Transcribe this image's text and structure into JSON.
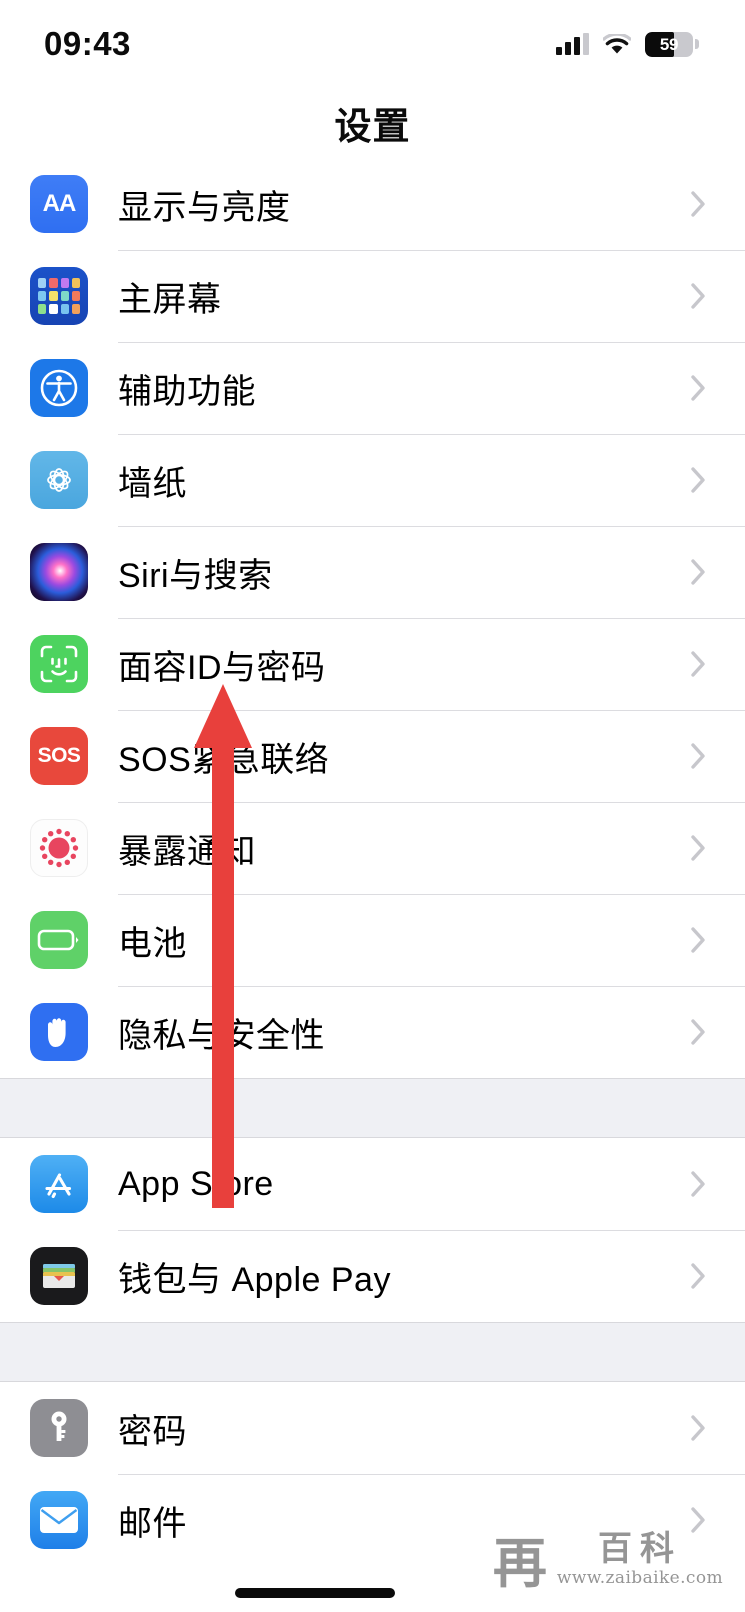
{
  "status_bar": {
    "time": "09:43",
    "signal_icon": "cellular-signal-icon",
    "wifi_icon": "wifi-icon",
    "battery_icon": "battery-icon",
    "battery_percent": "59",
    "battery_level": 60
  },
  "nav": {
    "title": "设置"
  },
  "sections": [
    {
      "id": "section-system",
      "rows": [
        {
          "label": "显示与亮度",
          "icon": "display-brightness-icon",
          "icon_class": "ic-display"
        },
        {
          "label": "主屏幕",
          "icon": "home-screen-icon",
          "icon_class": "ic-home"
        },
        {
          "label": "辅助功能",
          "icon": "accessibility-icon",
          "icon_class": "ic-access"
        },
        {
          "label": "墙纸",
          "icon": "wallpaper-icon",
          "icon_class": "ic-wallpaper"
        },
        {
          "label": "Siri与搜索",
          "icon": "siri-search-icon",
          "icon_class": "ic-siri"
        },
        {
          "label": "面容ID与密码",
          "icon": "face-id-icon",
          "icon_class": "ic-faceid"
        },
        {
          "label": "SOS紧急联络",
          "icon": "emergency-sos-icon",
          "icon_class": "ic-sos"
        },
        {
          "label": "暴露通知",
          "icon": "exposure-notifications-icon",
          "icon_class": "ic-exposure"
        },
        {
          "label": "电池",
          "icon": "battery-settings-icon",
          "icon_class": "ic-battery"
        },
        {
          "label": "隐私与安全性",
          "icon": "privacy-security-icon",
          "icon_class": "ic-privacy"
        }
      ]
    },
    {
      "id": "section-store",
      "rows": [
        {
          "label": "App Store",
          "icon": "app-store-icon",
          "icon_class": "ic-appstore"
        },
        {
          "label": "钱包与 Apple Pay",
          "icon": "wallet-apple-pay-icon",
          "icon_class": "ic-wallet"
        }
      ]
    },
    {
      "id": "section-accounts",
      "rows": [
        {
          "label": "密码",
          "icon": "passwords-icon",
          "icon_class": "ic-passwords"
        },
        {
          "label": "邮件",
          "icon": "mail-icon",
          "icon_class": "ic-mail"
        }
      ]
    }
  ],
  "annotation": {
    "arrow_color": "#e8403c",
    "points_at": "面容ID与密码"
  },
  "watermark": {
    "mark": "再",
    "name": "百科",
    "url": "www.zaibaike.com"
  },
  "colors": {
    "accent_blue": "#2f6ff1",
    "separator": "#dcdce0",
    "group_background": "#eff0f4",
    "chevron": "#c7c7cc"
  }
}
